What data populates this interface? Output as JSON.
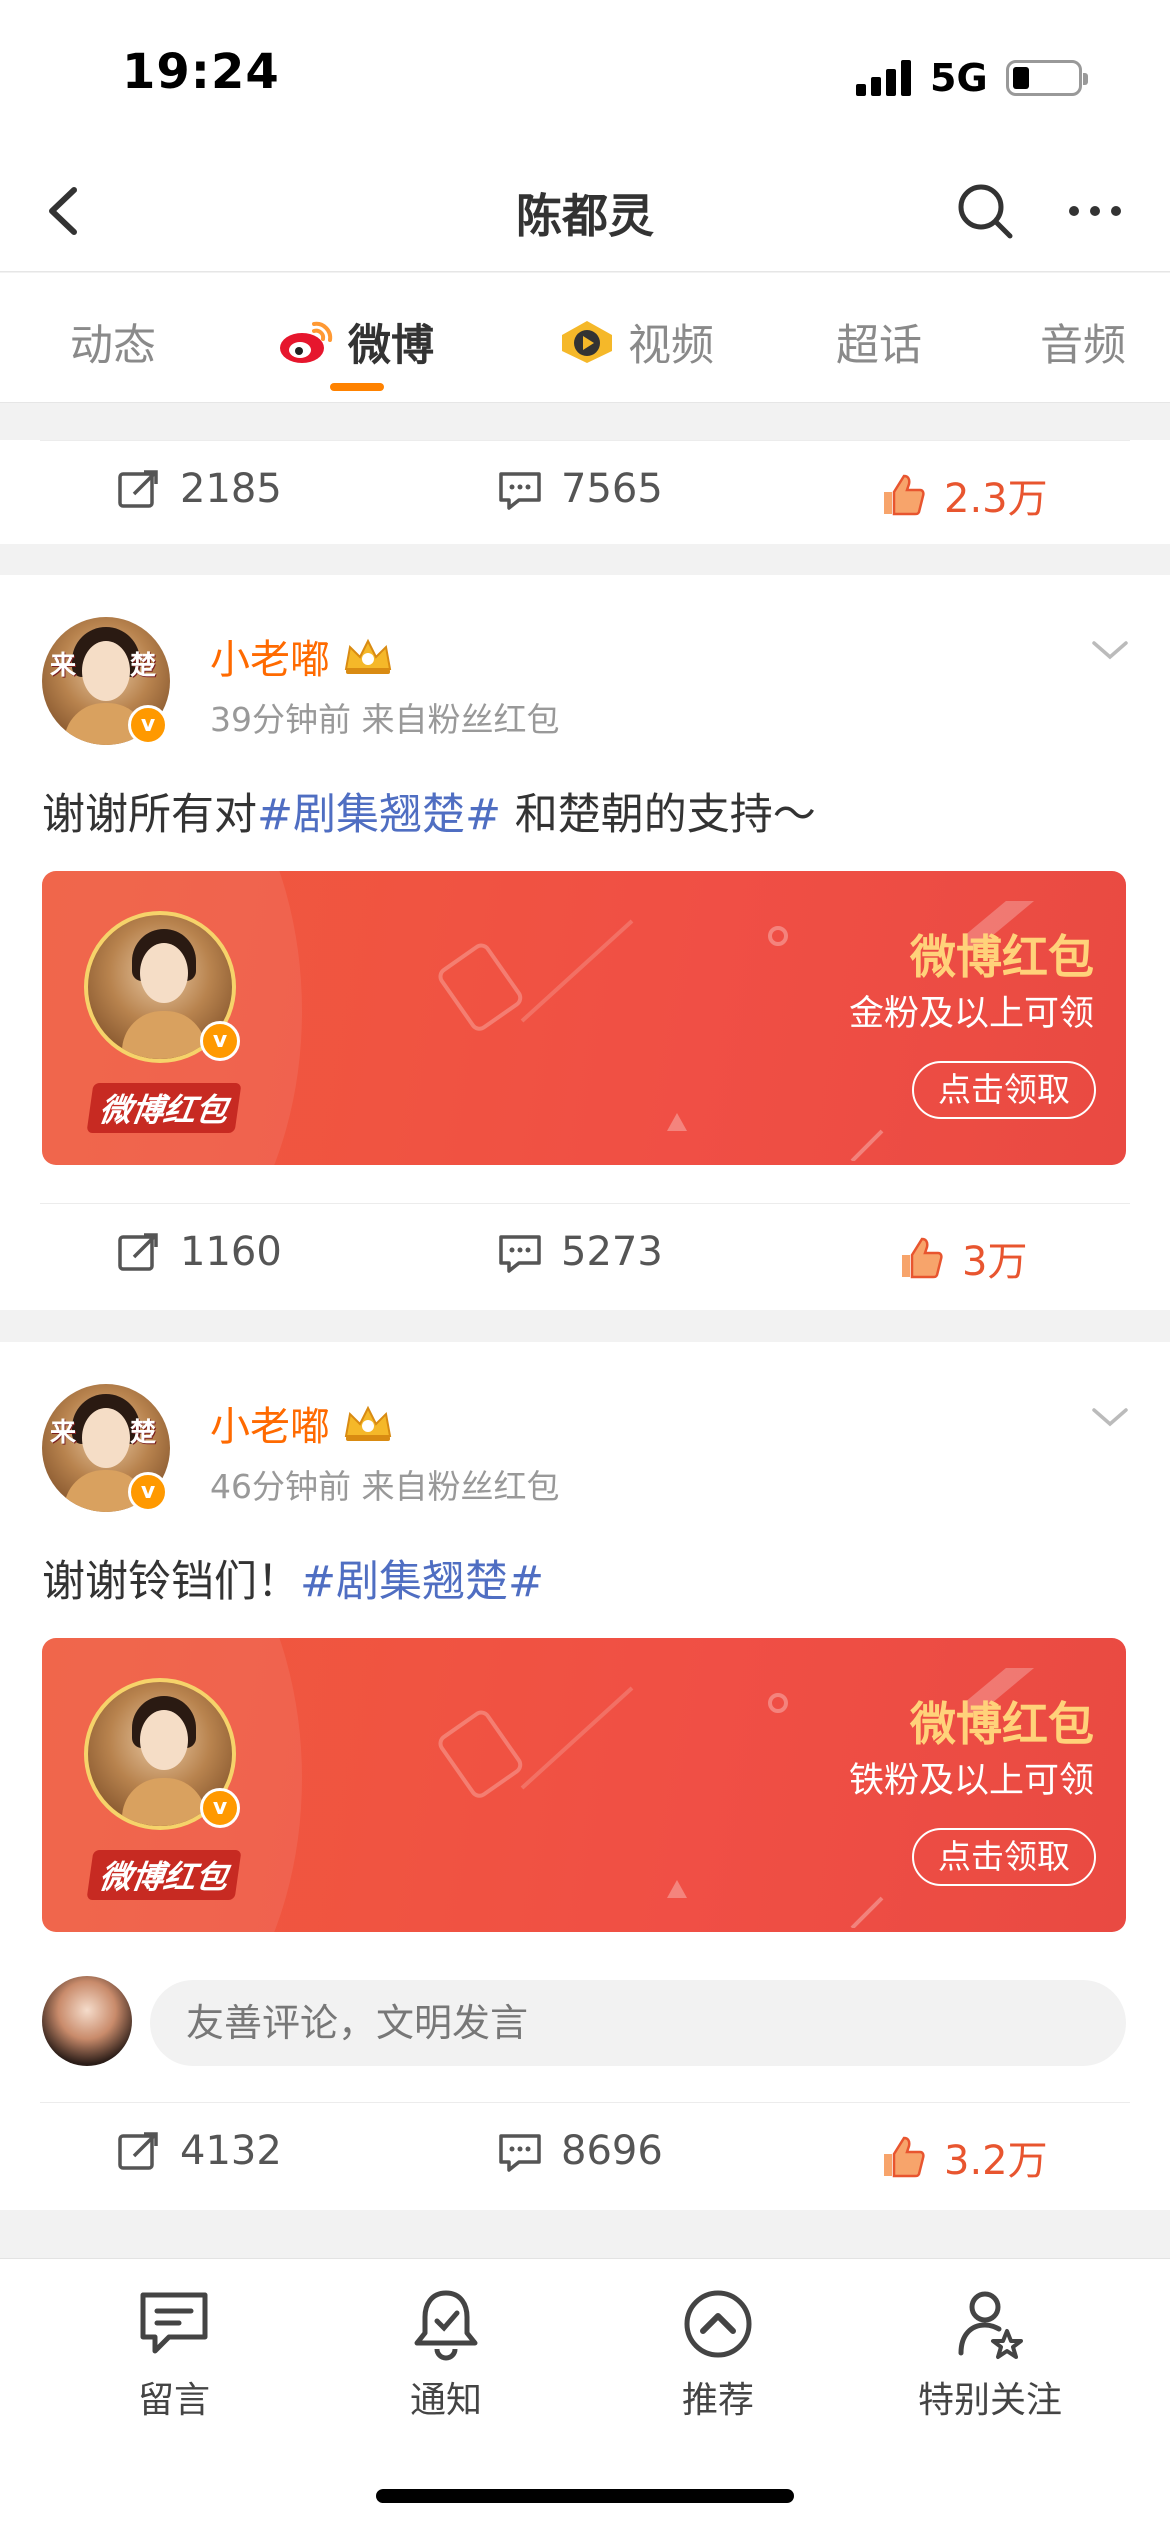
{
  "status_bar": {
    "time": "19:24",
    "network": "5G"
  },
  "header": {
    "title": "陈都灵"
  },
  "tabs": [
    {
      "label": "动态"
    },
    {
      "label": "微博"
    },
    {
      "label": "视频"
    },
    {
      "label": "超话"
    },
    {
      "label": "音频"
    }
  ],
  "top_actions": {
    "reposts": "2185",
    "comments": "7565",
    "likes": "2.3万"
  },
  "posts": [
    {
      "username": "小老嘟",
      "meta": "39分钟前  来自粉丝红包",
      "text_before": "谢谢所有对",
      "hashtag": "#剧集翘楚#",
      "text_after": " 和楚朝的支持～",
      "red_packet": {
        "title": "微博红包",
        "subtitle": "金粉及以上可领",
        "button": "点击领取",
        "logo": "微博红包"
      },
      "actions": {
        "reposts": "1160",
        "comments": "5273",
        "likes": "3万"
      }
    },
    {
      "username": "小老嘟",
      "meta": "46分钟前  来自粉丝红包",
      "text_before": "谢谢铃铛们！",
      "hashtag": "#剧集翘楚#",
      "text_after": "",
      "red_packet": {
        "title": "微博红包",
        "subtitle": "铁粉及以上可领",
        "button": "点击领取",
        "logo": "微博红包"
      },
      "comment_placeholder": "友善评论，文明发言",
      "actions": {
        "reposts": "4132",
        "comments": "8696",
        "likes": "3.2万"
      }
    }
  ],
  "bottom_nav": [
    {
      "label": "留言",
      "icon": "message-icon"
    },
    {
      "label": "通知",
      "icon": "bell-icon"
    },
    {
      "label": "推荐",
      "icon": "recommend-icon"
    },
    {
      "label": "特别关注",
      "icon": "special-follow-icon"
    }
  ],
  "colors": {
    "accent": "#ff8200",
    "like": "#e8552f",
    "hashtag": "#4f6ec2",
    "username": "#ff6a00",
    "red_packet": "#ef5a3c"
  }
}
